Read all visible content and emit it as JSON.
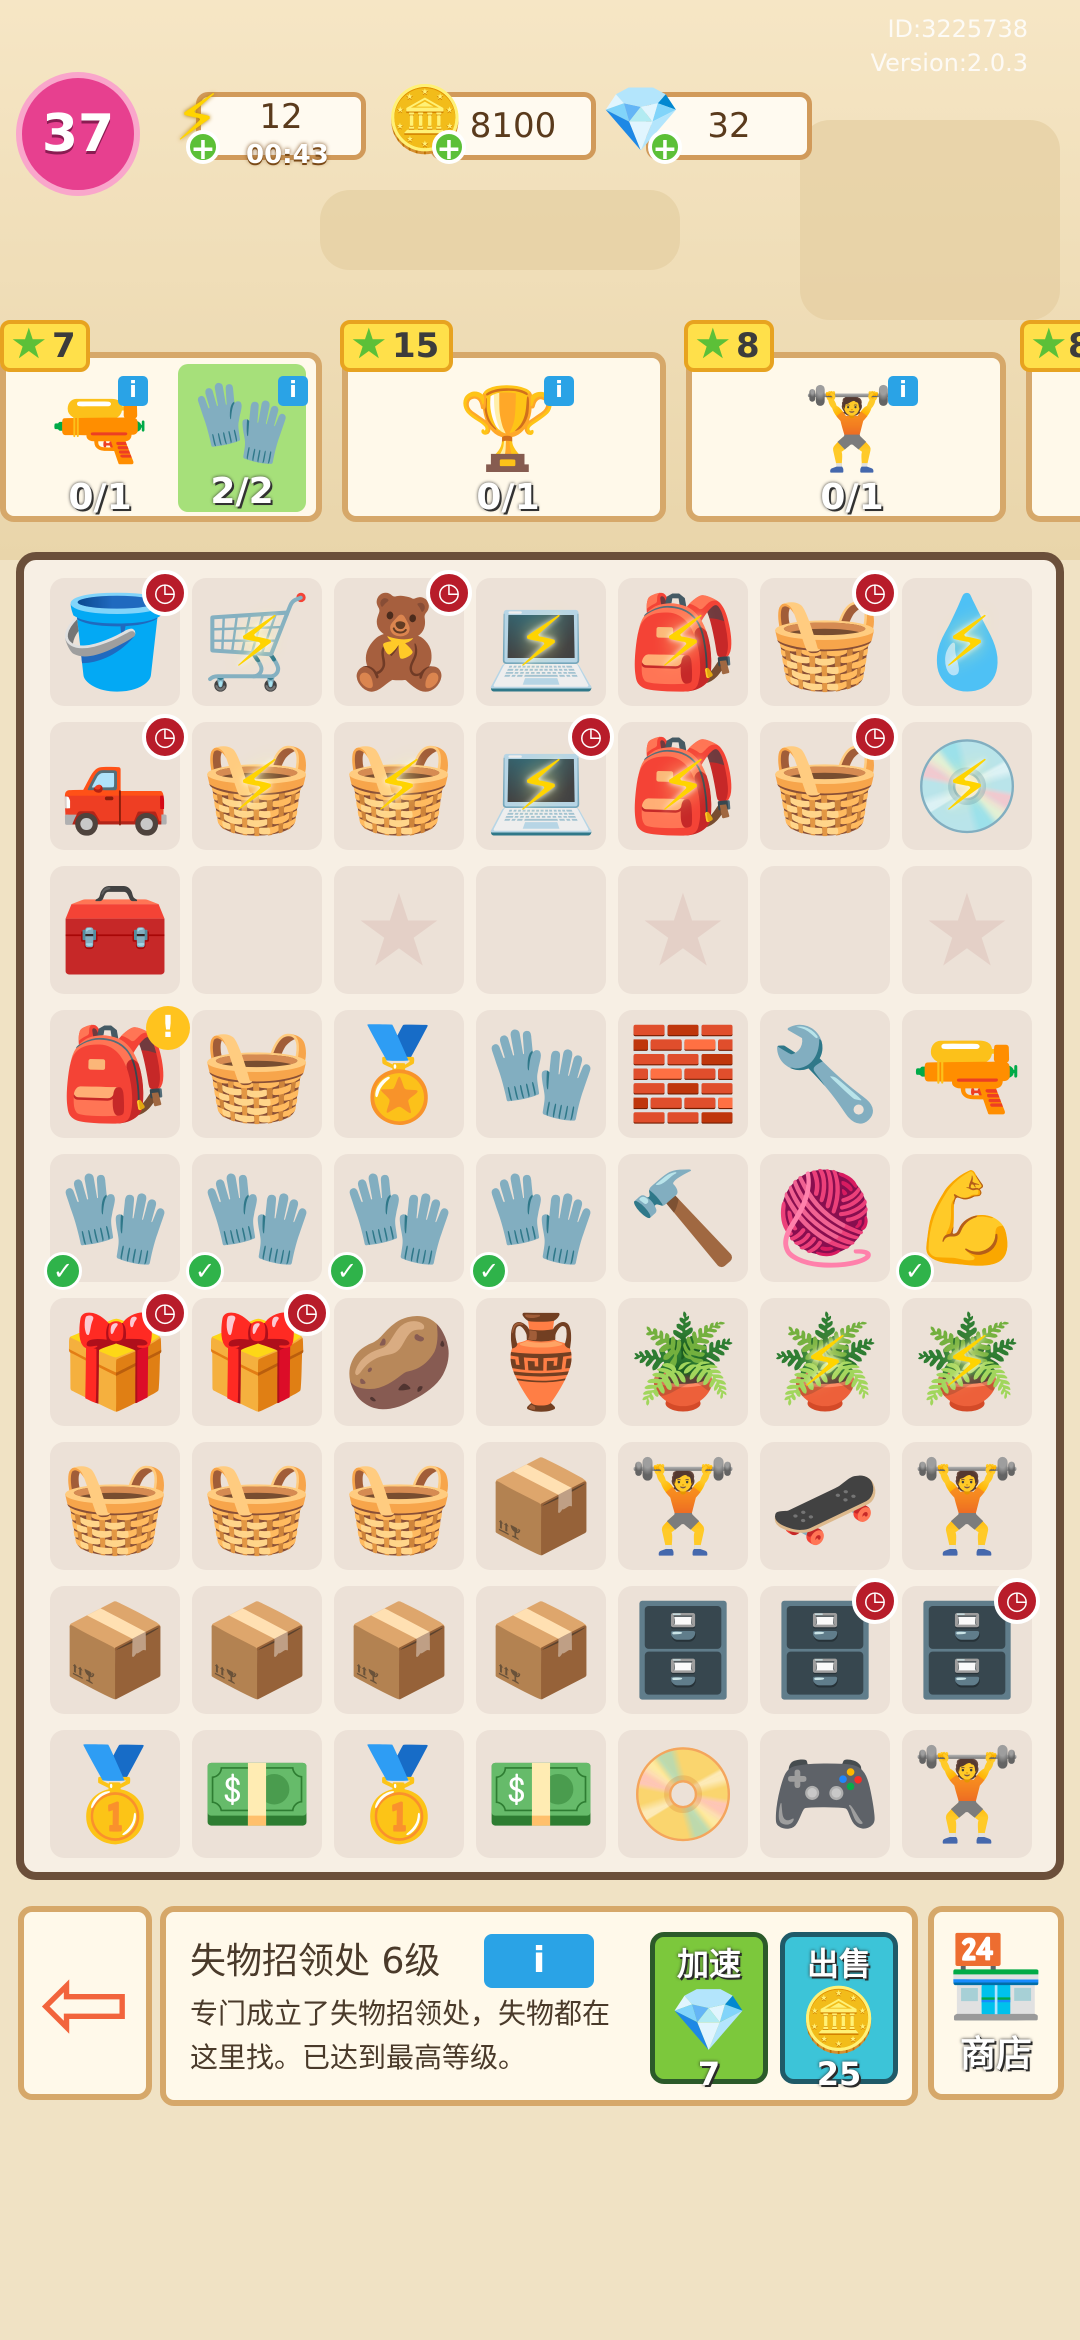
{
  "meta": {
    "id_text": "ID:3225738",
    "version_text": "Version:2.0.3"
  },
  "player": {
    "level": "37"
  },
  "resources": {
    "energy": {
      "value": "12",
      "timer": "00:43",
      "icon": "lightning-icon"
    },
    "coins": {
      "value": "8100",
      "icon": "coin-icon"
    },
    "gems": {
      "value": "32",
      "icon": "gem-icon"
    }
  },
  "orders": [
    {
      "stars": "7",
      "items": [
        {
          "icon": "drill",
          "count": "0/1"
        },
        {
          "icon": "gloves",
          "count": "2/2",
          "done": true
        }
      ]
    },
    {
      "stars": "15",
      "items": [
        {
          "icon": "trophy",
          "count": "0/1"
        }
      ]
    },
    {
      "stars": "8",
      "items": [
        {
          "icon": "exercise-machine",
          "count": "0/1"
        }
      ]
    },
    {
      "stars": "8",
      "items": []
    }
  ],
  "board": {
    "rows": [
      [
        "🪣",
        "🛒",
        "🧸",
        "💻",
        "🎒",
        "🧺",
        "💧"
      ],
      [
        "🛻",
        "🧺",
        "🧺",
        "💻",
        "🎒",
        "🧺",
        "💧"
      ],
      [
        "🧰",
        "",
        "★",
        "",
        "★",
        "",
        "★"
      ],
      [
        "🎒",
        "🧺",
        "🏅",
        "🧤",
        "🧱",
        "🔧",
        "🔫"
      ],
      [
        "🧤",
        "🧤",
        "🧤",
        "🧤",
        "🔨",
        "🧶",
        "💪"
      ],
      [
        "🎁",
        "🎁",
        "🥔",
        "🏺",
        "🪴",
        "🪴",
        "🪴"
      ],
      [
        "🧺",
        "🧺",
        "🧺",
        "📦",
        "🏋️",
        "🛹",
        "🏋️"
      ],
      [
        "📦",
        "📦",
        "📦",
        "📦",
        "🗄️",
        "🗄️",
        "🗄️"
      ],
      [
        "🥇",
        "💵",
        "🥇",
        "💵",
        "📀",
        "🎮",
        "🏋️"
      ]
    ]
  },
  "bottom_panel": {
    "title": "失物招领处 6级",
    "info_label": "i",
    "description": "专门成立了失物招领处，失物都在这里找。已达到最高等级。",
    "speedup": {
      "label": "加速",
      "cost": "7",
      "icon": "gem-icon"
    },
    "sell": {
      "label": "出售",
      "price": "25",
      "icon": "coin-icon"
    },
    "shop": {
      "label": "商店",
      "icon": "shop-icon"
    },
    "exit_icon": "exit-icon"
  }
}
